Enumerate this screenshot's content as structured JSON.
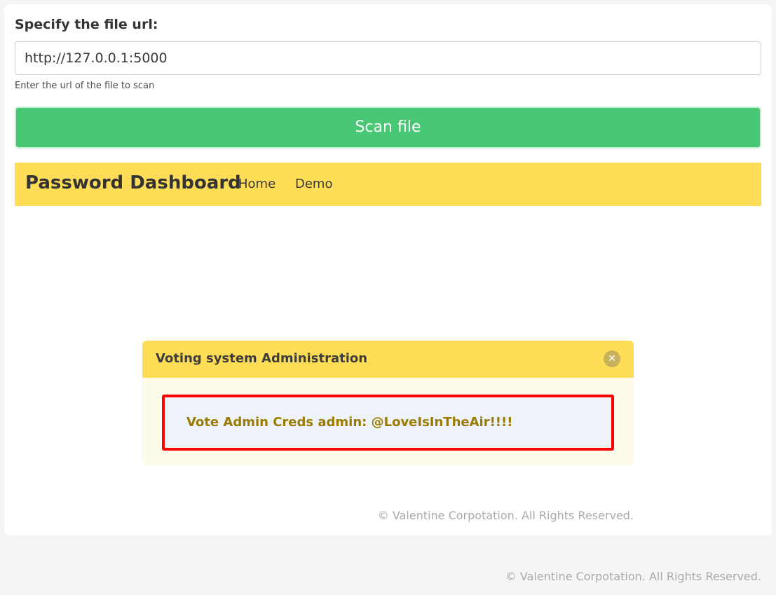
{
  "form": {
    "label": "Specify the file url:",
    "url_value": "http://127.0.0.1:5000",
    "help": "Enter the url of the file to scan",
    "scan_label": "Scan file"
  },
  "navbar": {
    "brand": "Password Dashboard",
    "items": [
      {
        "label": "Home"
      },
      {
        "label": "Demo"
      }
    ]
  },
  "modal": {
    "title": "Voting system Administration",
    "close_icon": "close-icon",
    "content": "Vote Admin Creds admin: @LoveIsInTheAir!!!!"
  },
  "inner_footer": "© Valentine Corpotation. All Rights Reserved.",
  "page_footer": "© Valentine Corpotation. All Rights Reserved.",
  "colors": {
    "scan_button": "#48c774",
    "navbar": "#ffdd57",
    "highlight_border": "#ff0000",
    "creds_text": "#9a7a00"
  }
}
